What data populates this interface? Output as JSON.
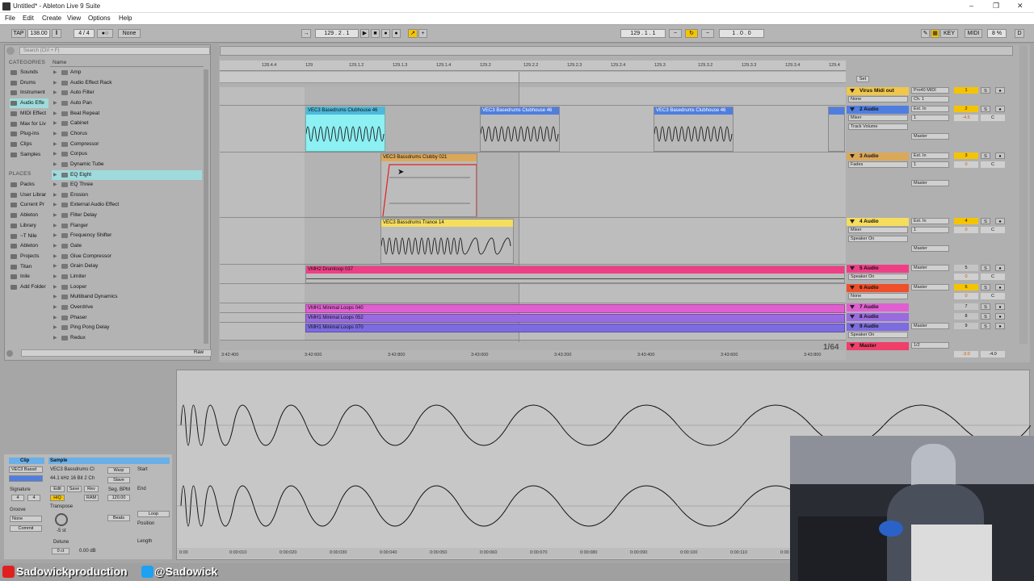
{
  "window": {
    "title": "Untitled* - Ableton Live 9 Suite"
  },
  "menu": [
    "File",
    "Edit",
    "Create",
    "View",
    "Options",
    "Help"
  ],
  "transport": {
    "tap": "TAP",
    "tempo": "138.00",
    "time_sig": "4 / 4",
    "metro": "1 Bar",
    "quantize": "None",
    "position": "129 . 2 . 1",
    "loop_start": "129 . 1 . 1",
    "loop_length": "1 . 0 . 0",
    "key": "KEY",
    "midi": "MIDI",
    "cpu": "8 %",
    "d": "D"
  },
  "browser": {
    "search_placeholder": "Search (Ctrl + F)",
    "categories_title": "CATEGORIES",
    "categories": [
      "Sounds",
      "Drums",
      "Instrument",
      "Audio Effe",
      "MIDI Effect",
      "Max for Liv",
      "Plug-ins",
      "Clips",
      "Samples"
    ],
    "places_title": "PLACES",
    "places": [
      "Packs",
      "User Librar",
      "Current Pr",
      "Ableton",
      "Library",
      "~T Nile",
      "Ableton",
      "Projects",
      "Titan",
      "Inile",
      "Add Folder"
    ],
    "list_header": "Name",
    "items": [
      "Amp",
      "Audio Effect Rack",
      "Auto Filter",
      "Auto Pan",
      "Beat Repeat",
      "Cabinet",
      "Chorus",
      "Compressor",
      "Corpus",
      "Dynamic Tube",
      "EQ Eight",
      "EQ Three",
      "Erosion",
      "External Audio Effect",
      "Filter Delay",
      "Flanger",
      "Frequency Shifter",
      "Gate",
      "Glue Compressor",
      "Grain Delay",
      "Limiter",
      "Looper",
      "Multiband Dynamics",
      "Overdrive",
      "Phaser",
      "Ping Pong Delay",
      "Redux"
    ],
    "preview_label": "Raw"
  },
  "ruler": [
    "128.4.4",
    "129",
    "129.1.2",
    "129.1.3",
    "129.1.4",
    "129.2",
    "129.2.2",
    "129.2.3",
    "129.2.4",
    "129.3",
    "129.3.2",
    "129.3.3",
    "129.3.4",
    "129.4"
  ],
  "clips": {
    "c1": "VEC3 Basedrums Clubhouse 46",
    "c2": "VEC3 Basedrums Clubhouse 46",
    "c3": "VEC3 Basedrums Clubhouse 46",
    "c4": "VEC3 Bassdrums Clubby 021",
    "c5": "VEC3 Bassdrums Trance 14",
    "c6": "VMH2 Drumloop 037",
    "c7": "VMH1 Minimal Loops 040",
    "c8": "VMH1 Minimal Loops 052",
    "c9": "VMH1 Minimal Loops 070"
  },
  "timeline": [
    "3:42:400",
    "3:42:600",
    "3:42:800",
    "3:43:000",
    "3:43:200",
    "3:43:400",
    "3:43:600",
    "3:43:800"
  ],
  "zoom": "1/64",
  "set_label": "Set",
  "tracks": [
    {
      "name": "Virus Midi out",
      "color": "#f0c74a",
      "in": "Pro40 MIDI",
      "sub": "Ch. 1",
      "dev": "None",
      "num": "1"
    },
    {
      "name": "2 Audio",
      "color": "#4f7ee0",
      "in": "Ext. In",
      "sub": "1",
      "dev": "Mixer",
      "dev2": "Track Volume",
      "vol": "-4.5",
      "pan": "C",
      "out": "Master",
      "num": "2"
    },
    {
      "name": "3 Audio",
      "color": "#dba85a",
      "in": "Ext. In",
      "sub": "1",
      "dev": "Fades",
      "vol": "0",
      "pan": "C",
      "out": "Master",
      "num": "3"
    },
    {
      "name": "4 Audio",
      "color": "#f5dd5e",
      "in": "Ext. In",
      "sub": "1",
      "dev": "Mixer",
      "dev2": "Speaker On",
      "vol": "0",
      "pan": "C",
      "out": "Master",
      "num": "4"
    },
    {
      "name": "5 Audio",
      "color": "#ee3f86",
      "in": "Master",
      "dev": "Speaker On",
      "vol": "0",
      "pan": "C",
      "num": "5"
    },
    {
      "name": "6 Audio",
      "color": "#ef4f2a",
      "in": "Master",
      "dev": "None",
      "vol": "0",
      "pan": "C",
      "num": "6"
    },
    {
      "name": "7 Audio",
      "color": "#e05fd0",
      "num": "7"
    },
    {
      "name": "8 Audio",
      "color": "#9a6be0",
      "num": "8"
    },
    {
      "name": "9 Audio",
      "color": "#7d6be0",
      "in": "Master",
      "dev": "Speaker On",
      "num": "9"
    },
    {
      "name": "Master",
      "color": "#ef3f6a",
      "in": "1/2",
      "vol": "-3.0",
      "pan": "-4.0"
    }
  ],
  "clipview": {
    "clip_title": "Clip",
    "clip_name": "VEC3 Bassd",
    "sample_title": "Sample",
    "sample_name": "VEC3 Bassdrums Cl",
    "sample_info": "44.1 kHz 16 Bit 2 Ch",
    "edit": "Edit",
    "save": "Save",
    "rev": "Rev",
    "hiq": "HiQ",
    "ram": "RAM",
    "warp": "Warp",
    "slave": "Slave",
    "start": "Start",
    "end": "End",
    "seg_bpm": "Seg. BPM",
    "bpm_val": "120.00",
    "signature": "Signature",
    "sig_num": "4",
    "sig_den": "4",
    "groove": "Groove",
    "groove_val": "None",
    "commit": "Commit",
    "transpose": "Transpose",
    "transpose_val": "-5 st",
    "detune": "Detune",
    "detune_val": "0 ct",
    "gain": "0.00 dB",
    "loop": "Loop",
    "position": "Position",
    "length": "Length",
    "beats": "Beats"
  },
  "sample_ruler": [
    "0:00",
    "0:00:010",
    "0:00:020",
    "0:00:030",
    "0:00:040",
    "0:00:050",
    "0:00:060",
    "0:00:070",
    "0:00:080",
    "0:00:090",
    "0:00:100",
    "0:00:110",
    "0:00"
  ],
  "status": {
    "left": "Sadowickproduction",
    "right": "@Sadowick"
  }
}
